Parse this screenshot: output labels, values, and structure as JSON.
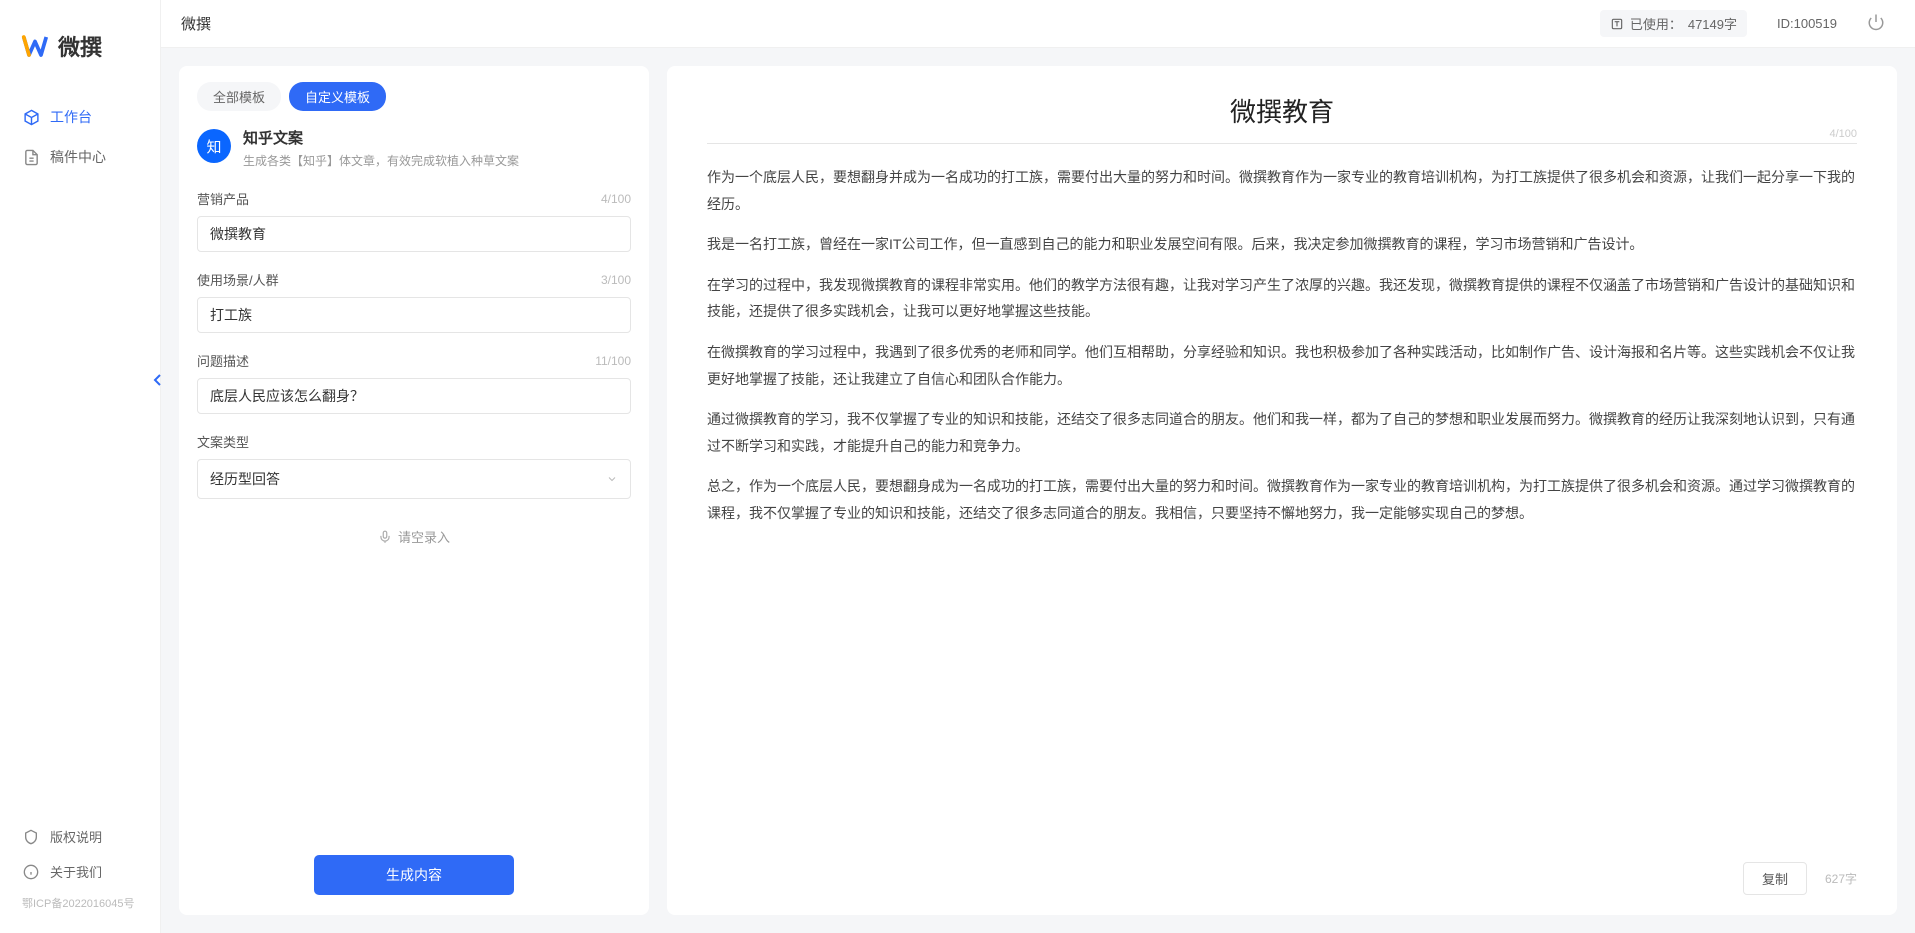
{
  "app": {
    "name": "微撰",
    "title": "微撰"
  },
  "topbar": {
    "usage_label": "已使用：",
    "usage_value": "47149字",
    "id_label": "ID:100519"
  },
  "sidebar": {
    "nav": [
      {
        "label": "工作台",
        "active": true
      },
      {
        "label": "稿件中心",
        "active": false
      }
    ],
    "footer": [
      {
        "label": "版权说明"
      },
      {
        "label": "关于我们"
      }
    ],
    "copyright": "鄂ICP备2022016045号"
  },
  "tabs": {
    "all": "全部模板",
    "custom": "自定义模板"
  },
  "template": {
    "icon_text": "知",
    "name": "知乎文案",
    "desc": "生成各类【知乎】体文章，有效完成软植入种草文案"
  },
  "form": {
    "product_label": "营销产品",
    "product_value": "微撰教育",
    "product_count": "4/100",
    "scene_label": "使用场景/人群",
    "scene_value": "打工族",
    "scene_count": "3/100",
    "problem_label": "问题描述",
    "problem_value": "底层人民应该怎么翻身？",
    "problem_count": "11/100",
    "type_label": "文案类型",
    "type_value": "经历型回答",
    "recording": "请空录入",
    "generate": "生成内容"
  },
  "output": {
    "title": "微撰教育",
    "title_count": "4/100",
    "paragraphs": [
      "作为一个底层人民，要想翻身并成为一名成功的打工族，需要付出大量的努力和时间。微撰教育作为一家专业的教育培训机构，为打工族提供了很多机会和资源，让我们一起分享一下我的经历。",
      "我是一名打工族，曾经在一家IT公司工作，但一直感到自己的能力和职业发展空间有限。后来，我决定参加微撰教育的课程，学习市场营销和广告设计。",
      "在学习的过程中，我发现微撰教育的课程非常实用。他们的教学方法很有趣，让我对学习产生了浓厚的兴趣。我还发现，微撰教育提供的课程不仅涵盖了市场营销和广告设计的基础知识和技能，还提供了很多实践机会，让我可以更好地掌握这些技能。",
      "在微撰教育的学习过程中，我遇到了很多优秀的老师和同学。他们互相帮助，分享经验和知识。我也积极参加了各种实践活动，比如制作广告、设计海报和名片等。这些实践机会不仅让我更好地掌握了技能，还让我建立了自信心和团队合作能力。",
      "通过微撰教育的学习，我不仅掌握了专业的知识和技能，还结交了很多志同道合的朋友。他们和我一样，都为了自己的梦想和职业发展而努力。微撰教育的经历让我深刻地认识到，只有通过不断学习和实践，才能提升自己的能力和竞争力。",
      "总之，作为一个底层人民，要想翻身成为一名成功的打工族，需要付出大量的努力和时间。微撰教育作为一家专业的教育培训机构，为打工族提供了很多机会和资源。通过学习微撰教育的课程，我不仅掌握了专业的知识和技能，还结交了很多志同道合的朋友。我相信，只要坚持不懈地努力，我一定能够实现自己的梦想。"
    ],
    "copy": "复制",
    "word_count": "627字"
  }
}
